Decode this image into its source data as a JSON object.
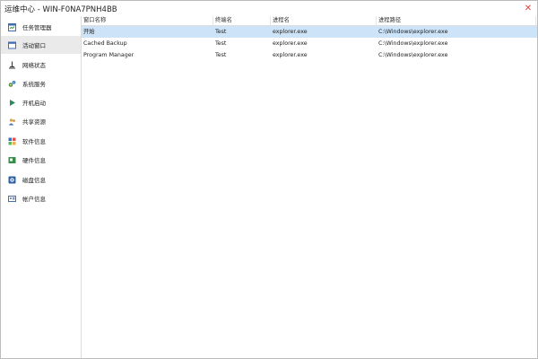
{
  "window": {
    "title": "运维中心 - WIN-F0NA7PNH4BB",
    "close_glyph": "✕"
  },
  "sidebar": {
    "items": [
      {
        "label": "任务管理器",
        "icon": "task-manager-icon",
        "active": false
      },
      {
        "label": "活动窗口",
        "icon": "window-icon",
        "active": true
      },
      {
        "label": "网络状态",
        "icon": "network-icon",
        "active": false
      },
      {
        "label": "系统服务",
        "icon": "gears-icon",
        "active": false
      },
      {
        "label": "开机启动",
        "icon": "play-icon",
        "active": false
      },
      {
        "label": "共享资源",
        "icon": "users-icon",
        "active": false
      },
      {
        "label": "软件信息",
        "icon": "software-icon",
        "active": false
      },
      {
        "label": "硬件信息",
        "icon": "hardware-icon",
        "active": false
      },
      {
        "label": "磁盘信息",
        "icon": "disk-icon",
        "active": false
      },
      {
        "label": "帐户信息",
        "icon": "account-card-icon",
        "active": false
      }
    ]
  },
  "table": {
    "columns": [
      "窗口名称",
      "终端名",
      "进程名",
      "进程路径"
    ],
    "rows": [
      {
        "window_name": "开始",
        "terminal": "Test",
        "process": "explorer.exe",
        "path": "C:\\Windows\\explorer.exe",
        "selected": true
      },
      {
        "window_name": "Cached Backup",
        "terminal": "Test",
        "process": "explorer.exe",
        "path": "C:\\Windows\\explorer.exe",
        "selected": false
      },
      {
        "window_name": "Program Manager",
        "terminal": "Test",
        "process": "explorer.exe",
        "path": "C:\\Windows\\explorer.exe",
        "selected": false
      }
    ]
  },
  "colors": {
    "selection": "#cde3f7",
    "active_nav": "#eaeaea",
    "close": "#e04343"
  }
}
